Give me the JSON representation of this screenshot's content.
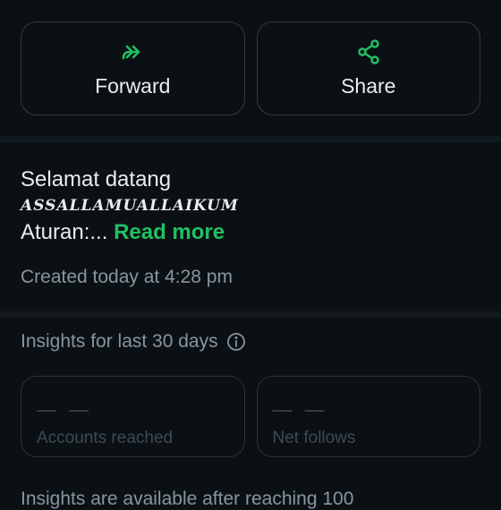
{
  "actions": [
    {
      "label": "Forward",
      "icon": "forward-icon"
    },
    {
      "label": "Share",
      "icon": "share-icon"
    }
  ],
  "description": {
    "line1": "Selamat datang",
    "line2": "ASSALLAMUALLAIKUM",
    "line3_prefix": "Aturan:...",
    "read_more": "Read more"
  },
  "created": "Created today at 4:28 pm",
  "insights": {
    "title": "Insights for last 30 days",
    "stats": [
      {
        "value": "— —",
        "label": "Accounts reached"
      },
      {
        "value": "— —",
        "label": "Net follows"
      }
    ],
    "footer": "Insights are available after reaching 100"
  },
  "colors": {
    "accent": "#21c063",
    "background": "#0b1014",
    "muted": "#8696a0"
  }
}
